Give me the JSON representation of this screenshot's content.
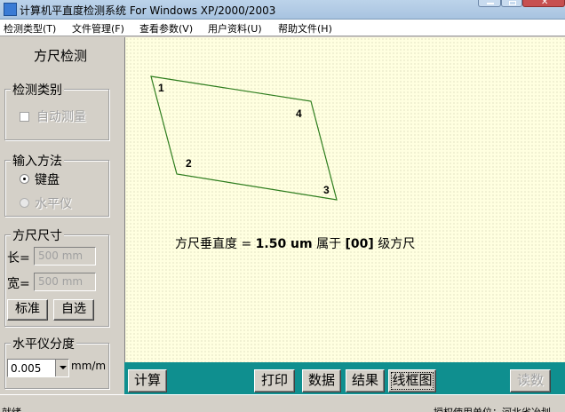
{
  "window": {
    "title": "计算机平直度检测系统   For Windows XP/2000/2003"
  },
  "menu": [
    "检测类型(T)",
    "文件管理(F)",
    "查看参数(V)",
    "用户资料(U)",
    "帮助文件(H)"
  ],
  "left_panel": {
    "title": "方尺检测",
    "detect_group": {
      "legend": "检测类别",
      "auto_measure_label": "自动测量",
      "auto_measure_checked": false
    },
    "input_group": {
      "legend": "输入方法",
      "keyboard_label": "键盘",
      "level_label": "水平仪",
      "selected": "键盘"
    },
    "size_group": {
      "legend": "方尺尺寸",
      "length_label": "长=",
      "length_value": "500 mm",
      "width_label": "宽=",
      "width_value": "500 mm",
      "standard_button": "标准",
      "custom_button": "自选"
    },
    "resolution_group": {
      "legend": "水平仪分度",
      "value": "0.005",
      "unit": "mm/m"
    }
  },
  "canvas": {
    "corner_labels": [
      "1",
      "2",
      "3",
      "4"
    ],
    "result": {
      "prefix": "方尺垂直度 = ",
      "value": "1.50 um",
      "middle": "  属于 ",
      "grade": "[00]",
      "suffix": " 级方尺"
    },
    "line_color": "#2e7d1e",
    "background": "#ffffe0"
  },
  "toolbar": {
    "calculate": "计算",
    "print": "打印",
    "data": "数据",
    "result": "结果",
    "wireframe": "线框图",
    "read": "读数"
  },
  "status": {
    "left": "就绪",
    "right": "授权使用单位：河北省冶划"
  }
}
